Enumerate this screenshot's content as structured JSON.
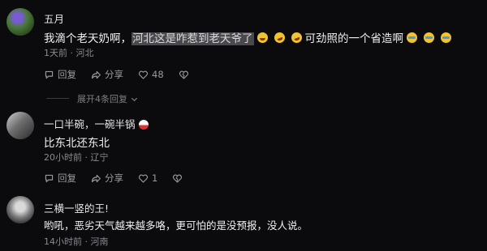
{
  "comments": [
    {
      "username": "五月",
      "text_pre": "我滴个老天奶啊，",
      "text_highlight": "河北这是咋惹到老天爷了",
      "text_mid": "可劲照的一个省造啊",
      "time": "1天前",
      "location": "河北",
      "reply_label": "回复",
      "share_label": "分享",
      "like_count": "48",
      "expand_label": "展开4条回复"
    },
    {
      "username": "一口半碗，一碗半锅",
      "text": "比东北还东北",
      "time": "20小时前",
      "location": "辽宁",
      "reply_label": "回复",
      "share_label": "分享",
      "like_count": "1"
    },
    {
      "username": "三横一竖的王!",
      "text": "哟吼，恶劣天气越来越多咯，更可怕的是没预报，没人说。",
      "time": "14小时前",
      "location": "河南"
    }
  ],
  "icons": [
    "reply-icon",
    "share-icon",
    "heart-icon",
    "dislike-icon",
    "chevron-down-icon"
  ],
  "colors": {
    "background": "#0b0b0d",
    "highlight": "#4a4a4e",
    "meta": "#8a8a90"
  }
}
